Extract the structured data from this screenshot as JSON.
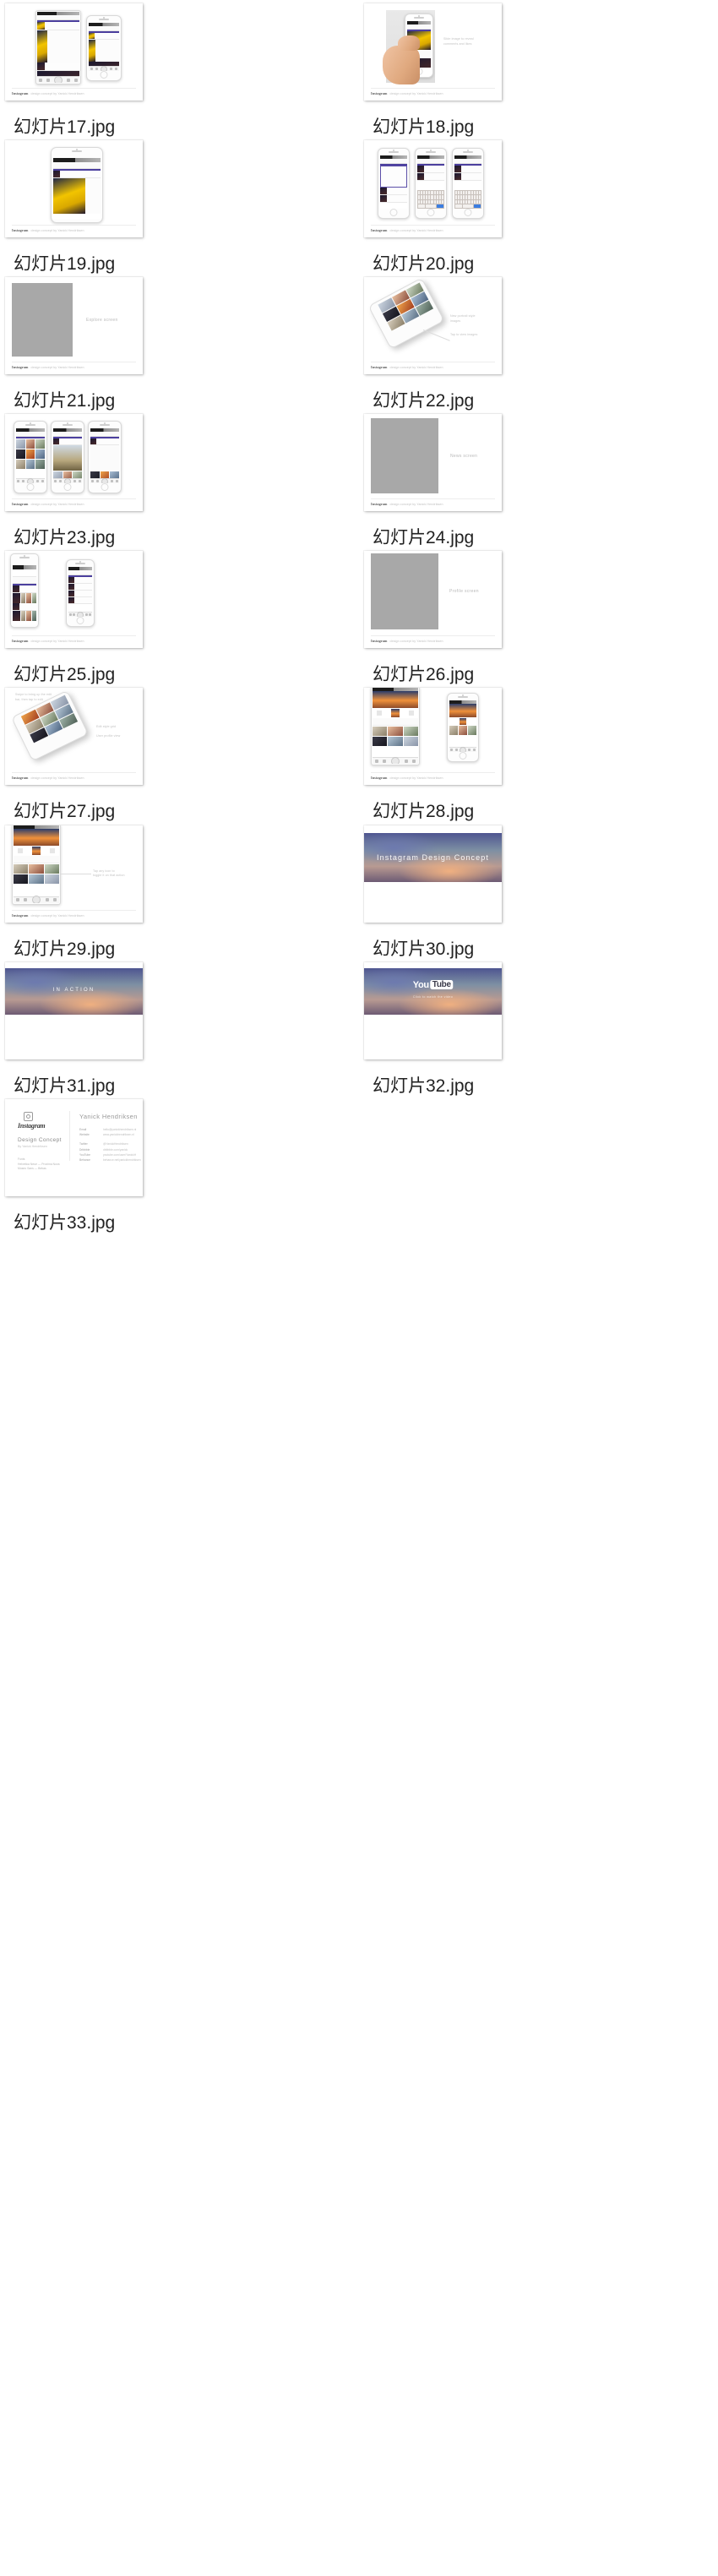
{
  "gallery": {
    "columns": 2,
    "items": [
      {
        "filename": "幻灯片17.jpg",
        "kind": "mockup-two-phones",
        "footer_brand": "Instagram",
        "footer_sub": "design concept by Yanick Hendriksen"
      },
      {
        "filename": "幻灯片18.jpg",
        "kind": "hand-holding-phone",
        "callout": "Slide image to reveal\ncomments and likes",
        "footer_brand": "Instagram",
        "footer_sub": "design concept by Yanick Hendriksen"
      },
      {
        "filename": "幻灯片19.jpg",
        "kind": "single-phone-feed",
        "footer_brand": "Instagram",
        "footer_sub": "design concept by Yanick Hendriksen"
      },
      {
        "filename": "幻灯片20.jpg",
        "kind": "three-phones-keyboard",
        "footer_brand": "Instagram",
        "footer_sub": "design concept by Yanick Hendriksen"
      },
      {
        "filename": "幻灯片21.jpg",
        "kind": "grey-placeholder",
        "placeholder_label": "Explore screen",
        "footer_brand": "Instagram",
        "footer_sub": "design concept by Yanick Hendriksen"
      },
      {
        "filename": "幻灯片22.jpg",
        "kind": "angled-phone-grid",
        "callout": "New portrait style\nimages",
        "callout2": "Tap to view images",
        "footer_brand": "Instagram",
        "footer_sub": "design concept by Yanick Hendriksen"
      },
      {
        "filename": "幻灯片23.jpg",
        "kind": "three-phones-explore",
        "footer_brand": "Instagram",
        "footer_sub": "design concept by Yanick Hendriksen"
      },
      {
        "filename": "幻灯片24.jpg",
        "kind": "grey-placeholder",
        "placeholder_label": "News screen",
        "footer_brand": "Instagram",
        "footer_sub": "design concept by Yanick Hendriksen"
      },
      {
        "filename": "幻灯片25.jpg",
        "kind": "two-phones-news",
        "footer_brand": "Instagram",
        "footer_sub": "design concept by Yanick Hendriksen"
      },
      {
        "filename": "幻灯片26.jpg",
        "kind": "grey-placeholder",
        "placeholder_label": "Profile screen",
        "footer_brand": "Instagram",
        "footer_sub": "design concept by Yanick Hendriksen"
      },
      {
        "filename": "幻灯片27.jpg",
        "kind": "angled-phone-profile",
        "callout": "Swipe to bring up the edit\nbar, then tap to edit",
        "callout2": "Edit style grid",
        "callout3": "User profile view",
        "footer_brand": "Instagram",
        "footer_sub": "design concept by Yanick Hendriksen"
      },
      {
        "filename": "幻灯片28.jpg",
        "kind": "two-phones-profile",
        "footer_brand": "Instagram",
        "footer_sub": "design concept by Yanick Hendriksen"
      },
      {
        "filename": "幻灯片29.jpg",
        "kind": "single-phone-profile",
        "callout": "Tap any icon to\ntoggle it on that action",
        "footer_brand": "Instagram",
        "footer_sub": "design concept by Yanick Hendriksen"
      },
      {
        "filename": "幻灯片30.jpg",
        "kind": "gradient-title",
        "title": "Instagram Design Concept"
      },
      {
        "filename": "幻灯片31.jpg",
        "kind": "gradient-title-small",
        "title": "IN ACTION"
      },
      {
        "filename": "幻灯片32.jpg",
        "kind": "gradient-youtube",
        "logo_you": "You",
        "logo_tube": "Tube",
        "subtitle": "Click to watch the video"
      },
      {
        "filename": "幻灯片33.jpg",
        "kind": "credits",
        "wordmark": "Instagram",
        "mark_name": "instagram-glyph-icon",
        "heading": "Design Concept",
        "heading_sub": "By Yanick Hendriksen",
        "left_block": "Fonts\nHelvetica Neue — Proxima Nova\nMuseo Sans — Bebas",
        "name": "Yanick Hendriksen",
        "rows": [
          {
            "key": "Email",
            "value": "hello@yanickhendriksen.nl"
          },
          {
            "key": "Website",
            "value": "www.yanickhendriksen.nl"
          },
          {
            "key": "Twitter",
            "value": "@YanickHendriksen"
          },
          {
            "key": "Dribbble",
            "value": "dribbble.com/yanick"
          },
          {
            "key": "YouTube",
            "value": "youtube.com/user/YanickH"
          },
          {
            "key": "Behance",
            "value": "behance.net/yanickhendriksen"
          }
        ]
      }
    ]
  },
  "colors": {
    "accent_purple": "#4b3f9e",
    "placeholder_grey": "#a8a8a8",
    "caption_text": "#222222",
    "gradient_top": "#4e5590",
    "gradient_mid": "#b89a92",
    "gradient_bottom": "#6d5b74"
  }
}
